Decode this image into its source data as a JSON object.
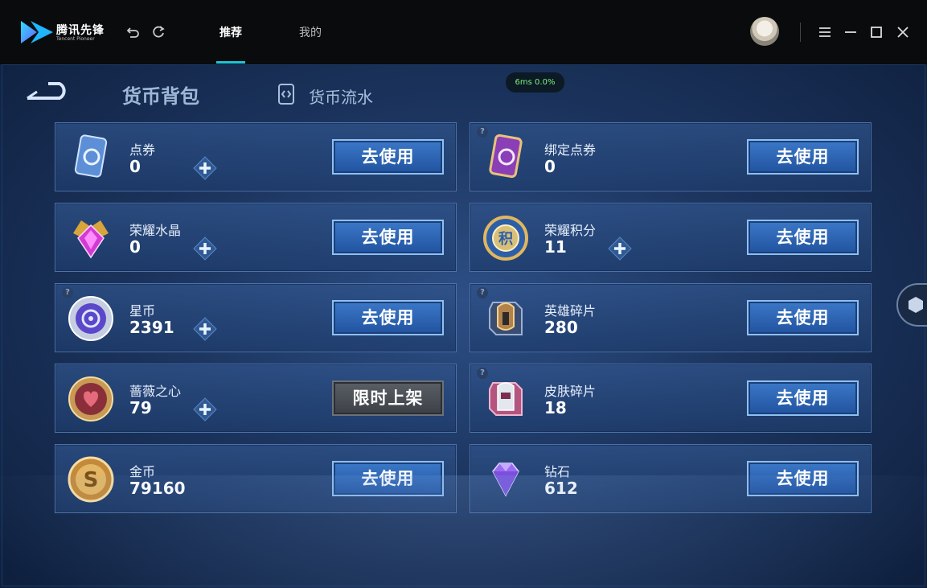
{
  "titlebar": {
    "brand": "腾讯先锋",
    "brand_sub": "Tencent Pioneer",
    "tabs": [
      {
        "label": "推荐",
        "active": true
      },
      {
        "label": "我的",
        "active": false
      }
    ],
    "accent_color": "#1fc4d8"
  },
  "page": {
    "title": "货币背包",
    "secondary_link": "货币流水",
    "perf_label": "6ms  0.0%"
  },
  "currencies": [
    {
      "name": "点券",
      "value": "0",
      "has_plus": true,
      "has_help": false,
      "button": "去使用",
      "button_style": "blue",
      "icon": "coupon-icon"
    },
    {
      "name": "绑定点券",
      "value": "0",
      "has_plus": false,
      "has_help": true,
      "button": "去使用",
      "button_style": "blue",
      "icon": "bound-coupon-icon"
    },
    {
      "name": "荣耀水晶",
      "value": "0",
      "has_plus": true,
      "has_help": false,
      "button": "去使用",
      "button_style": "blue",
      "icon": "glory-crystal-icon"
    },
    {
      "name": "荣耀积分",
      "value": "11",
      "has_plus": true,
      "has_help": false,
      "button": "去使用",
      "button_style": "blue",
      "icon": "glory-points-icon"
    },
    {
      "name": "星币",
      "value": "2391",
      "has_plus": true,
      "has_help": true,
      "button": "去使用",
      "button_style": "blue",
      "icon": "star-coin-icon"
    },
    {
      "name": "英雄碎片",
      "value": "280",
      "has_plus": false,
      "has_help": true,
      "button": "去使用",
      "button_style": "blue",
      "icon": "hero-fragment-icon"
    },
    {
      "name": "蔷薇之心",
      "value": "79",
      "has_plus": true,
      "has_help": false,
      "button": "限时上架",
      "button_style": "grey",
      "icon": "rose-heart-icon"
    },
    {
      "name": "皮肤碎片",
      "value": "18",
      "has_plus": false,
      "has_help": true,
      "button": "去使用",
      "button_style": "blue",
      "icon": "skin-fragment-icon"
    },
    {
      "name": "金币",
      "value": "79160",
      "has_plus": false,
      "has_help": false,
      "button": "去使用",
      "button_style": "blue",
      "icon": "gold-coin-icon"
    },
    {
      "name": "钻石",
      "value": "612",
      "has_plus": false,
      "has_help": false,
      "button": "去使用",
      "button_style": "blue",
      "icon": "diamond-icon"
    }
  ]
}
